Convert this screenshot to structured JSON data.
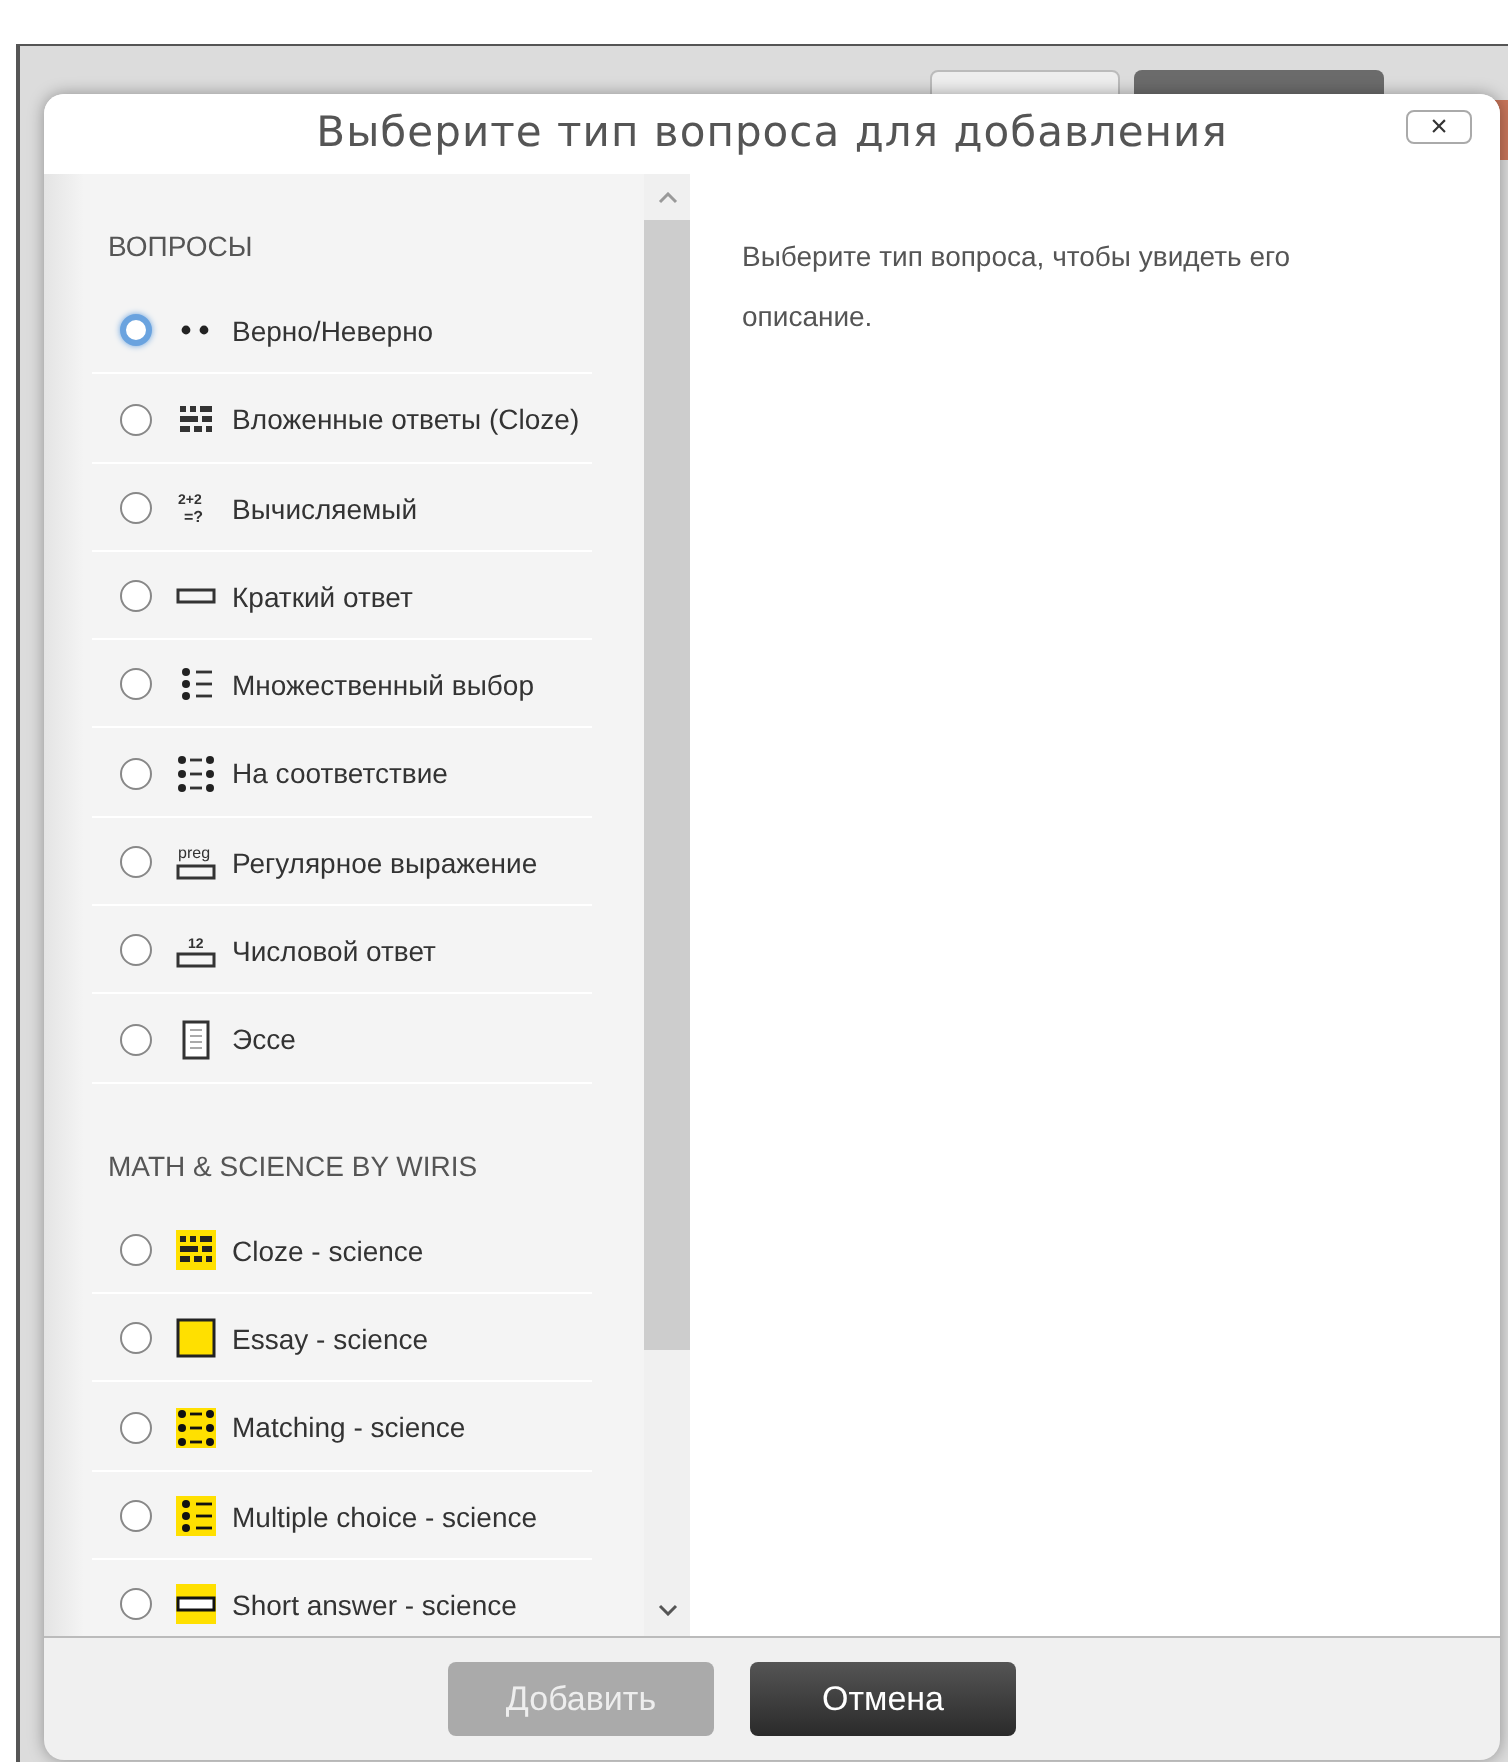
{
  "dialog": {
    "title": "Выберите тип вопроса для добавления",
    "close_label": "×",
    "groups": [
      {
        "heading": "ВОПРОСЫ",
        "items": [
          {
            "label": "Верно/Неверно",
            "focused": true
          },
          {
            "label": "Вложенные ответы (Cloze)",
            "focused": false
          },
          {
            "label": "Вычисляемый",
            "focused": false,
            "icon_text": [
              "2+2",
              "=?"
            ]
          },
          {
            "label": "Краткий ответ",
            "focused": false
          },
          {
            "label": "Множественный выбор",
            "focused": false
          },
          {
            "label": "На соответствие",
            "focused": false
          },
          {
            "label": "Регулярное выражение",
            "focused": false,
            "icon_text": [
              "preg"
            ]
          },
          {
            "label": "Числовой ответ",
            "focused": false,
            "icon_text": [
              "12"
            ]
          },
          {
            "label": "Эссе",
            "focused": false
          }
        ]
      },
      {
        "heading": "MATH & SCIENCE BY WIRIS",
        "items": [
          {
            "label": "Cloze - science",
            "focused": false
          },
          {
            "label": "Essay - science",
            "focused": false
          },
          {
            "label": "Matching - science",
            "focused": false
          },
          {
            "label": "Multiple choice - science",
            "focused": false
          },
          {
            "label": "Short answer - science",
            "focused": false
          }
        ]
      }
    ],
    "description": "Выберите тип вопроса, чтобы увидеть его описание.",
    "buttons": [
      {
        "label": "Добавить",
        "kind": "primary",
        "disabled": true
      },
      {
        "label": "Отмена",
        "kind": "secondary",
        "disabled": false
      }
    ]
  }
}
